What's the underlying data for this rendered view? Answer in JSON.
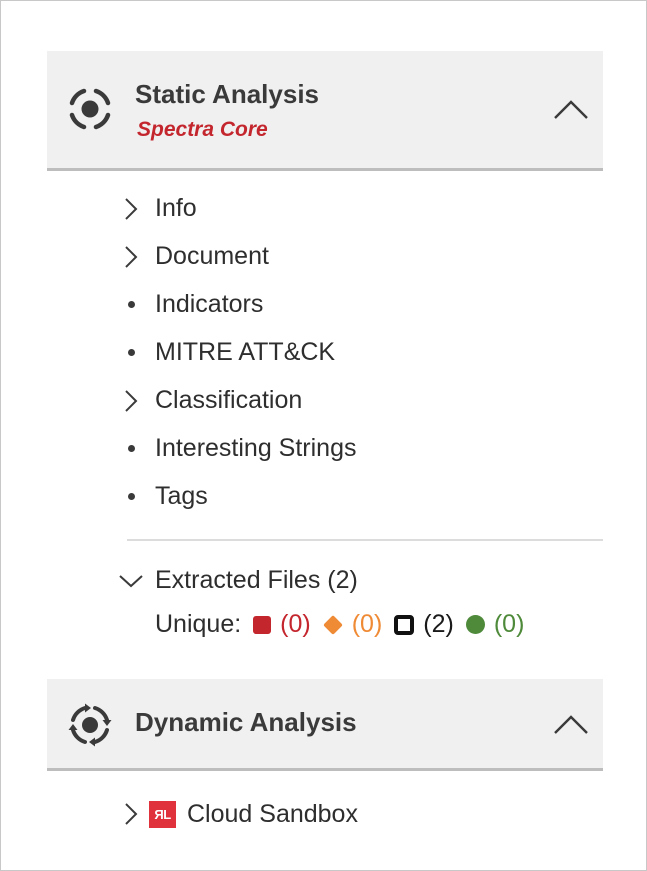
{
  "static_panel": {
    "title": "Static Analysis",
    "subtitle": "Spectra Core",
    "icon": "target-scan-icon",
    "collapse_icon": "chevron-up-icon"
  },
  "nav_items": [
    {
      "label": "Info",
      "marker": "chevron-right"
    },
    {
      "label": "Document",
      "marker": "chevron-right"
    },
    {
      "label": "Indicators",
      "marker": "bullet"
    },
    {
      "label": "MITRE ATT&CK",
      "marker": "bullet"
    },
    {
      "label": "Classification",
      "marker": "chevron-right"
    },
    {
      "label": "Interesting Strings",
      "marker": "bullet"
    },
    {
      "label": "Tags",
      "marker": "bullet"
    }
  ],
  "extracted_files": {
    "label": "Extracted Files (2)",
    "unique_label": "Unique:",
    "counts": [
      {
        "kind": "malicious",
        "shape": "red-square",
        "color": "#c4262e",
        "count": "(0)"
      },
      {
        "kind": "suspicious",
        "shape": "orange-diamond",
        "color": "#ef8a35",
        "count": "(0)"
      },
      {
        "kind": "unknown",
        "shape": "black-outlined-square",
        "color": "#1a1a1a",
        "count": "(2)"
      },
      {
        "kind": "goodware",
        "shape": "green-circle",
        "color": "#4e8a3a",
        "count": "(0)"
      }
    ]
  },
  "dynamic_panel": {
    "title": "Dynamic Analysis",
    "icon": "rotating-scan-icon",
    "collapse_icon": "chevron-up-icon"
  },
  "sandbox": {
    "logo_text": "ЯL",
    "label": "Cloud Sandbox"
  },
  "colors": {
    "panel_bg": "#f0f0f0",
    "accent_red": "#c4262e",
    "divider": "#dcdcdc"
  }
}
